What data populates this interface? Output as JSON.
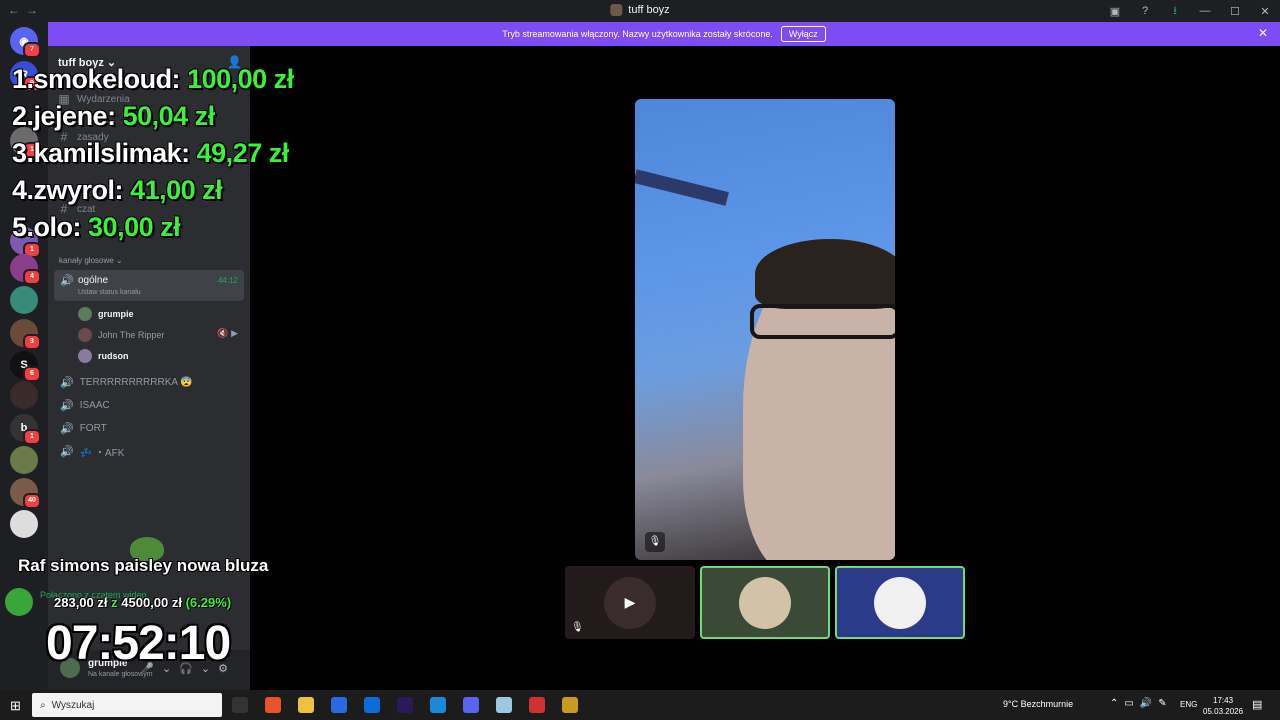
{
  "window": {
    "title": "tuff boyz"
  },
  "banner": {
    "text": "Tryb streamowania włączony. Nazwy użytkownika zostały skrócone.",
    "button": "Wyłącz"
  },
  "rail": {
    "badges": [
      "7",
      "9",
      "1",
      "1",
      "4",
      "3",
      "6",
      "1",
      "40"
    ]
  },
  "sidebar": {
    "guild_name": "tuff boyz",
    "channels": {
      "events": "Wydarzenia",
      "rules": "zasady",
      "chat": "czat",
      "other": "ogólne"
    },
    "voice_category": "kanały głosowe",
    "active_voice": {
      "name": "ogólne",
      "status": "Ustaw status kanału",
      "time": "44:12"
    },
    "members": [
      {
        "name": "grumpie"
      },
      {
        "name": "John The Ripper"
      },
      {
        "name": "rudson"
      }
    ],
    "voice_channels": [
      "TERRRRRRRRRRKA 😨",
      "ISAAC",
      "FORT",
      "💤 ・AFK"
    ]
  },
  "user": {
    "name": "grumpie",
    "status": "Na kanale głosowym",
    "voice_connected": "Połączono z czatem wideo"
  },
  "overlay": {
    "leaderboard": [
      {
        "rank": "1.",
        "name": "smokeloud:",
        "amount": "100,00 zł"
      },
      {
        "rank": "2.",
        "name": "jejene:",
        "amount": "50,04 zł"
      },
      {
        "rank": "3.",
        "name": "kamilslimak:",
        "amount": "49,27 zł"
      },
      {
        "rank": "4.",
        "name": "zwyrol:",
        "amount": "41,00 zł"
      },
      {
        "rank": "5.",
        "name": "olo:",
        "amount": "30,00 zł"
      }
    ],
    "goal_title": "Raf simons paisley nowa bluza",
    "goal_current": "283,00 zł",
    "goal_sep": "z",
    "goal_target": "4500,00 zł",
    "goal_percent": "(6.29%)",
    "clock": "07:52:10"
  },
  "taskbar": {
    "search_placeholder": "Wyszukaj",
    "weather_temp": "9°C",
    "weather_text": "Bezchmurnie",
    "lang": "ENG",
    "time": "17:43",
    "date": "05.03.2026"
  },
  "colors": {
    "accent": "#7f4bf4",
    "green": "#3cf03c",
    "speaking": "#6fdc6f"
  }
}
